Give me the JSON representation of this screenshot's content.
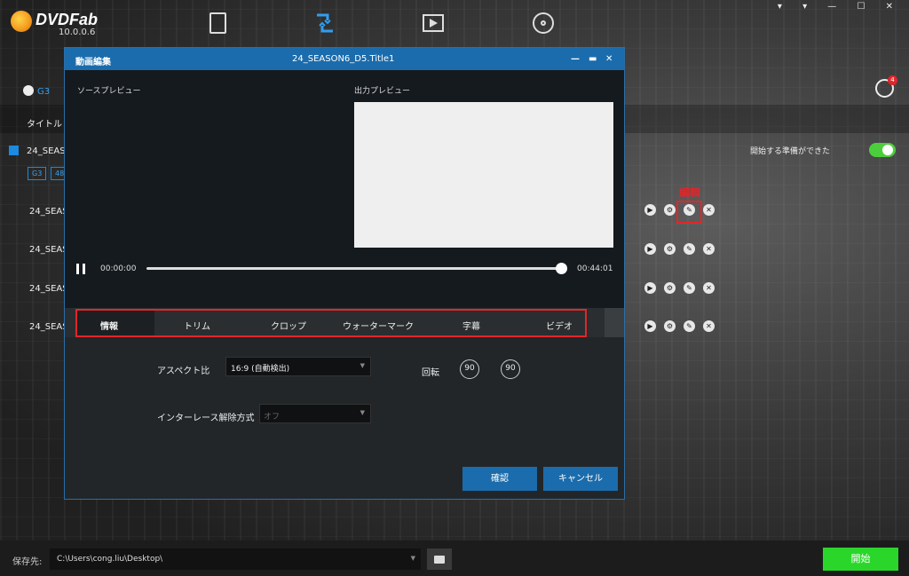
{
  "app": {
    "logo": "DVDFab",
    "version": "10.0.0.6",
    "nav_icons": [
      "document-icon",
      "convert-icon",
      "video-icon",
      "disc-icon"
    ]
  },
  "background_panel": {
    "source_label": "G3",
    "title_header": "タイトル",
    "main_title": "24_SEAS",
    "badges": [
      "G3",
      "48"
    ],
    "rows": [
      "24_SEAS",
      "24_SEAS",
      "24_SEAS",
      "24_SEAS"
    ],
    "ready_label": "開始する準備ができた",
    "queue_count": "4",
    "edit_annotation": "編輯"
  },
  "dialog": {
    "title": "動画編集",
    "file_name": "24_SEASON6_D5.Title1",
    "source_preview_label": "ソースプレビュー",
    "output_preview_label": "出力プレビュー",
    "time_current": "00:00:00",
    "time_total": "00:44:01",
    "progress": 1.0,
    "tabs": [
      "情報",
      "トリム",
      "クロップ",
      "ウォーターマーク",
      "字幕",
      "ビデオ"
    ],
    "active_tab": "情報",
    "aspect_label": "アスペクト比",
    "aspect_value": "16:9 (自動検出)",
    "rotate_label": "回転",
    "rotate_left": "90",
    "rotate_right": "90",
    "deinterlace_label": "インターレース解除方式",
    "deinterlace_value": "オフ",
    "ok_button": "確認",
    "cancel_button": "キャンセル"
  },
  "bottom": {
    "save_label": "保存先:",
    "save_path": "C:\\Users\\cong.liu\\Desktop\\",
    "start_button": "開始"
  },
  "colors": {
    "accent_blue": "#1b6cac",
    "highlight_red": "#e0262a",
    "start_green": "#2bd62b",
    "toggle_green": "#4cce3c"
  }
}
